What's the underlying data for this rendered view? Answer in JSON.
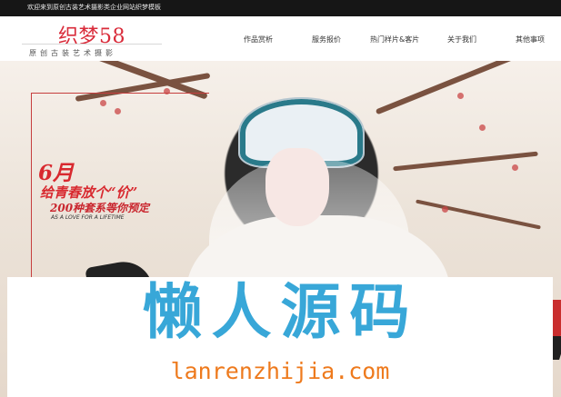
{
  "topbar": {
    "text": "欢迎来到原创古装艺术摄影类企业网站织梦模板"
  },
  "header": {
    "logo_title": "织梦58",
    "logo_subtitle": "原创古装艺术摄影",
    "nav": [
      {
        "label": "作品赏析"
      },
      {
        "label": "服务报价"
      },
      {
        "label": "热门样片&客片"
      },
      {
        "label": "关于我们"
      },
      {
        "label": "其他事项"
      }
    ]
  },
  "hero": {
    "promo": {
      "month": "6月",
      "line1": "给青春放个“价”",
      "line2": "200种套系等你预定",
      "line3": "AS A LOVE FOR A LIFETIME"
    }
  },
  "watermark": {
    "cn": "懒人源码",
    "en": "lanrenzhijia.com"
  },
  "colors": {
    "accent_red": "#d92b3a",
    "watermark_blue": "#38a7d8",
    "watermark_orange": "#ee7a1d",
    "topbar_bg": "#161616"
  }
}
